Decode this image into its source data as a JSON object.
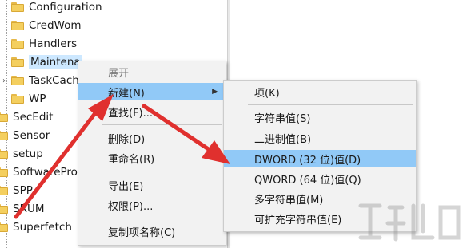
{
  "tree": {
    "items": [
      {
        "label": "Configuration"
      },
      {
        "label": "CredWom"
      },
      {
        "label": "Handlers"
      },
      {
        "label": "Maintena"
      },
      {
        "label": "TaskCach"
      },
      {
        "label": "WP"
      },
      {
        "label": "SecEdit"
      },
      {
        "label": "Sensor"
      },
      {
        "label": "setup"
      },
      {
        "label": "SoftwarePro"
      },
      {
        "label": "SPP"
      },
      {
        "label": "SRUM"
      },
      {
        "label": "Superfetch"
      }
    ]
  },
  "context_menu": {
    "items": [
      {
        "label": "展开"
      },
      {
        "label": "新建(N)"
      },
      {
        "label": "查找(F)..."
      },
      {
        "label": "删除(D)"
      },
      {
        "label": "重命名(R)"
      },
      {
        "label": "导出(E)"
      },
      {
        "label": "权限(P)..."
      },
      {
        "label": "复制项名称(C)"
      }
    ],
    "submenu_arrow": "▶"
  },
  "submenu": {
    "items": [
      {
        "label": "项(K)"
      },
      {
        "label": "字符串值(S)"
      },
      {
        "label": "二进制值(B)"
      },
      {
        "label": "DWORD (32 位)值(D)"
      },
      {
        "label": "QWORD (64 位)值(Q)"
      },
      {
        "label": "多字符串值(M)"
      },
      {
        "label": "可扩充字符串值(E)"
      }
    ]
  },
  "icons": {
    "chevron": "›",
    "folder": "folder-icon"
  },
  "colors": {
    "highlight": "#91c9f7",
    "arrow": "#e0302e",
    "selected": "#cde8ff"
  }
}
